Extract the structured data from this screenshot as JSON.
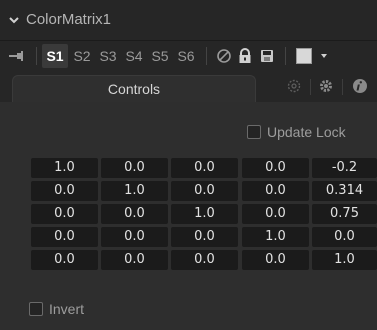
{
  "node": {
    "title": "ColorMatrix1"
  },
  "toolbar": {
    "slots": [
      {
        "label": "S1",
        "active": true
      },
      {
        "label": "S2",
        "active": false
      },
      {
        "label": "S3",
        "active": false
      },
      {
        "label": "S4",
        "active": false
      },
      {
        "label": "S5",
        "active": false
      },
      {
        "label": "S6",
        "active": false
      }
    ],
    "swatch_color": "#d8d8d8"
  },
  "tabs": {
    "controls_label": "Controls"
  },
  "controls": {
    "update_lock_label": "Update Lock",
    "update_lock_checked": false,
    "invert_label": "Invert",
    "invert_checked": false,
    "matrix": [
      [
        "1.0",
        "0.0",
        "0.0",
        "0.0",
        "-0.2"
      ],
      [
        "0.0",
        "1.0",
        "0.0",
        "0.0",
        "0.314"
      ],
      [
        "0.0",
        "0.0",
        "1.0",
        "0.0",
        "0.75"
      ],
      [
        "0.0",
        "0.0",
        "0.0",
        "1.0",
        "0.0"
      ],
      [
        "0.0",
        "0.0",
        "0.0",
        "0.0",
        "1.0"
      ]
    ]
  },
  "colors": {
    "panel_bg": "#2e2e2e",
    "header_bg": "#262626",
    "field_bg": "#1b1b1b",
    "text": "#e2e2e2"
  }
}
